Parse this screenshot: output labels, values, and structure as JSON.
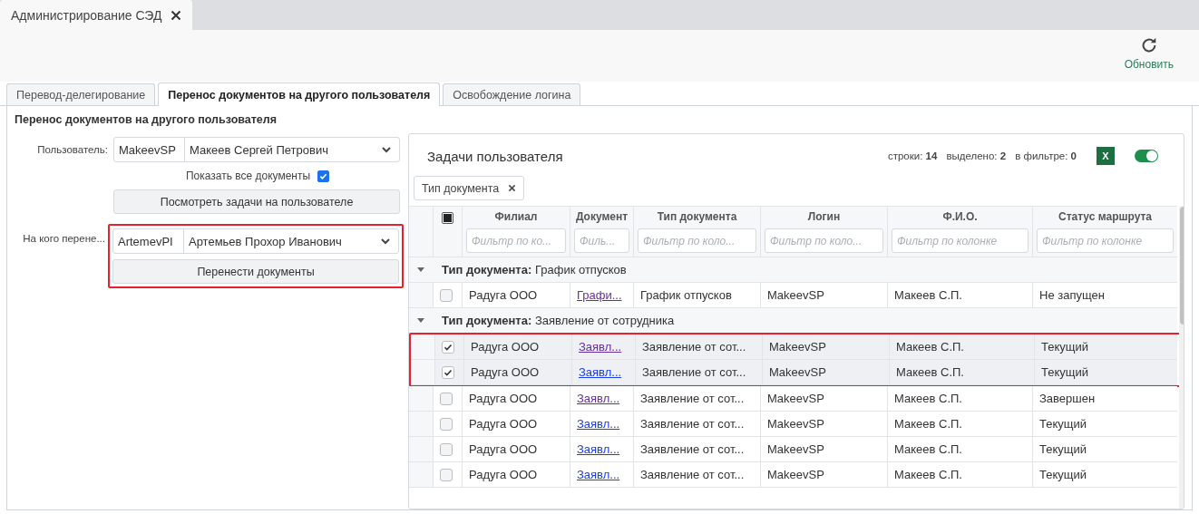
{
  "app_tab": {
    "title": "Администрирование СЭД"
  },
  "toolbar": {
    "refresh": "Обновить"
  },
  "tabs": [
    {
      "label": "Перевод-делегирование",
      "selected": false
    },
    {
      "label": "Перенос документов на другого пользователя",
      "selected": true
    },
    {
      "label": "Освобождение логина",
      "selected": false
    }
  ],
  "section_title": "Перенос документов на другого пользователя",
  "user": {
    "label": "Пользователь:",
    "login": "MakeevSP",
    "name": "Макеев Сергей Петрович"
  },
  "show_all": {
    "label": "Показать все документы",
    "checked": true
  },
  "view_button": "Посмотреть задачи на пользователе",
  "target": {
    "label": "На кого перене...",
    "login": "ArtemevPI",
    "name": "Артемьев Прохор Иванович",
    "button": "Перенести документы",
    "highlighted": true
  },
  "grid": {
    "title": "Задачи пользователя",
    "stats": [
      {
        "label": "строки:",
        "value": "14"
      },
      {
        "label": "выделено:",
        "value": "2"
      },
      {
        "label": "в фильтре:",
        "value": "0"
      }
    ],
    "excel": "X",
    "toggle_on": true,
    "group_chip": "Тип документа",
    "header_partial": true,
    "columns": [
      "Филиал",
      "Документ",
      "Тип документа",
      "Логин",
      "Ф.И.О.",
      "Статус маршрута"
    ],
    "filter_placeholders": [
      "Фильтр по ко...",
      "Филь...",
      "Фильтр по коло...",
      "Фильтр по коло...",
      "Фильтр по колонке",
      "Фильтр по колонке"
    ],
    "groups": [
      {
        "label": "Тип документа:",
        "value": "График отпусков",
        "expanded": true,
        "rows": [
          {
            "cells": [
              "Радуга ООО",
              "Графи...",
              "График отпусков",
              "MakeevSP",
              "Макеев С.П.",
              "Не запущен"
            ],
            "checked": false,
            "visited": true,
            "highlighted": false
          }
        ]
      },
      {
        "label": "Тип документа:",
        "value": "Заявление от сотрудника",
        "expanded": true,
        "rows": [
          {
            "cells": [
              "Радуга ООО",
              "Заявл...",
              "Заявление от сот...",
              "MakeevSP",
              "Макеев С.П.",
              "Текущий"
            ],
            "checked": true,
            "visited": true,
            "highlighted": true
          },
          {
            "cells": [
              "Радуга ООО",
              "Заявл...",
              "Заявление от сот...",
              "MakeevSP",
              "Макеев С.П.",
              "Текущий"
            ],
            "checked": true,
            "visited": false,
            "highlighted": true
          },
          {
            "cells": [
              "Радуга ООО",
              "Заявл...",
              "Заявление от сот...",
              "MakeevSP",
              "Макеев С.П.",
              "Завершен"
            ],
            "checked": false,
            "visited": true,
            "highlighted": false
          },
          {
            "cells": [
              "Радуга ООО",
              "Заявл...",
              "Заявление от сот...",
              "MakeevSP",
              "Макеев С.П.",
              "Текущий"
            ],
            "checked": false,
            "visited": false,
            "highlighted": false
          },
          {
            "cells": [
              "Радуга ООО",
              "Заявл...",
              "Заявление от сот...",
              "MakeevSP",
              "Макеев С.П.",
              "Текущий"
            ],
            "checked": false,
            "visited": false,
            "highlighted": false
          },
          {
            "cells": [
              "Радуга ООО",
              "Заявл...",
              "Заявление от сот...",
              "MakeevSP",
              "Макеев С.П.",
              "Текущий"
            ],
            "checked": false,
            "visited": false,
            "highlighted": false
          }
        ]
      }
    ]
  }
}
